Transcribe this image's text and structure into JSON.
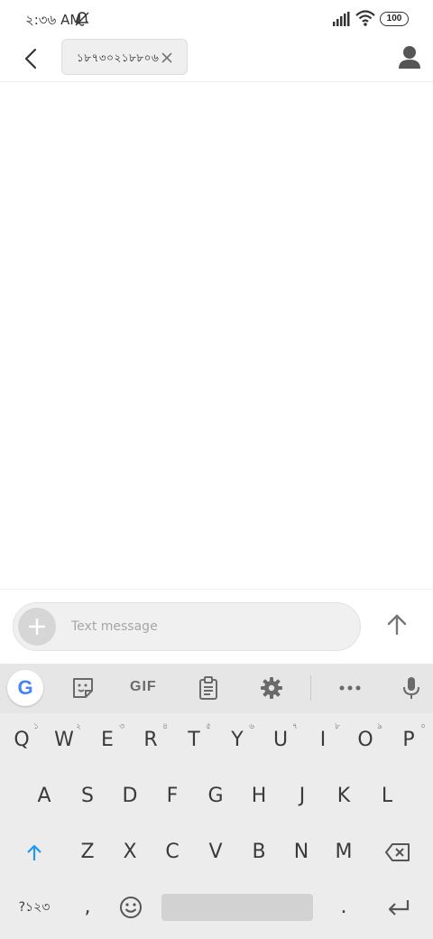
{
  "status_bar": {
    "time": "২:৩৬ AM",
    "battery": "100"
  },
  "header": {
    "recipient": "১৮৭৩০২১৮৮০৬"
  },
  "composer": {
    "placeholder": "Text message"
  },
  "keyboard": {
    "toolbar": {
      "gif_label": "GIF"
    },
    "row1": [
      {
        "label": "Q",
        "hint": "১"
      },
      {
        "label": "W",
        "hint": "২"
      },
      {
        "label": "E",
        "hint": "৩"
      },
      {
        "label": "R",
        "hint": "৪"
      },
      {
        "label": "T",
        "hint": "৫"
      },
      {
        "label": "Y",
        "hint": "৬"
      },
      {
        "label": "U",
        "hint": "৭"
      },
      {
        "label": "I",
        "hint": "৮"
      },
      {
        "label": "O",
        "hint": "৯"
      },
      {
        "label": "P",
        "hint": "০"
      }
    ],
    "row2": [
      "A",
      "S",
      "D",
      "F",
      "G",
      "H",
      "J",
      "K",
      "L"
    ],
    "row3": [
      "Z",
      "X",
      "C",
      "V",
      "B",
      "N",
      "M"
    ],
    "row4": {
      "symbols": "?১২৩",
      "comma": ",",
      "period": "."
    }
  },
  "colors": {
    "accent": "#2196f3",
    "keyboard_bg": "#ececec",
    "toolbar_bg": "#e6e6e6"
  }
}
